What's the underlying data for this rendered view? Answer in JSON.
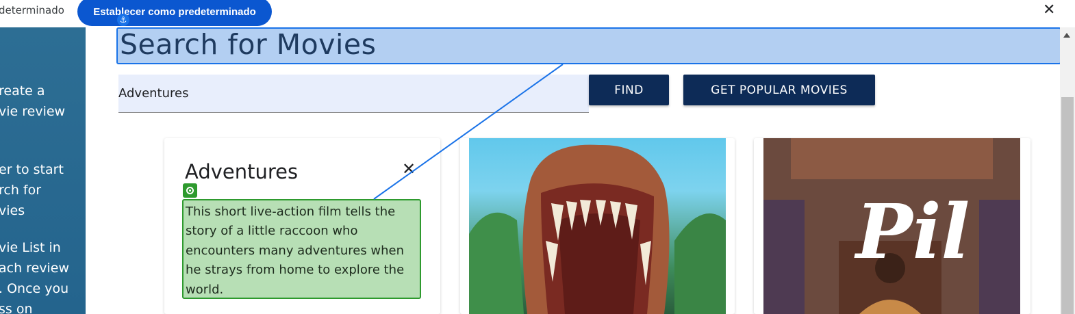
{
  "infobar": {
    "left_text": "determinado",
    "set_default_label": "Establecer como predeterminado",
    "close_label": "✕"
  },
  "sidebar": {
    "lines": [
      "reate a",
      "vie review",
      "er to start",
      "rch for",
      "vies",
      "vie List in",
      "ach review",
      ". Once you",
      "ss on"
    ]
  },
  "main": {
    "title": "Search for Movies",
    "search": {
      "value": "Adventures"
    },
    "find_label": "FIND",
    "popular_label": "GET POPULAR MOVIES",
    "card": {
      "title": "Adventures",
      "close": "✕",
      "description": "This short live-action film tells the story of a little raccoon who encounters many adventures when he strays from home to explore the world."
    },
    "posters": [
      {
        "name": "dinosaur-poster",
        "logo_text": ""
      },
      {
        "name": "pil-poster",
        "logo_text": "Pil"
      }
    ]
  },
  "colors": {
    "accent_blue": "#0b57d0",
    "button_navy": "#0d2b57",
    "sidebar": "#2d6e94",
    "highlight_blue": "#b3cff2",
    "highlight_green": "#b7dfb5"
  }
}
